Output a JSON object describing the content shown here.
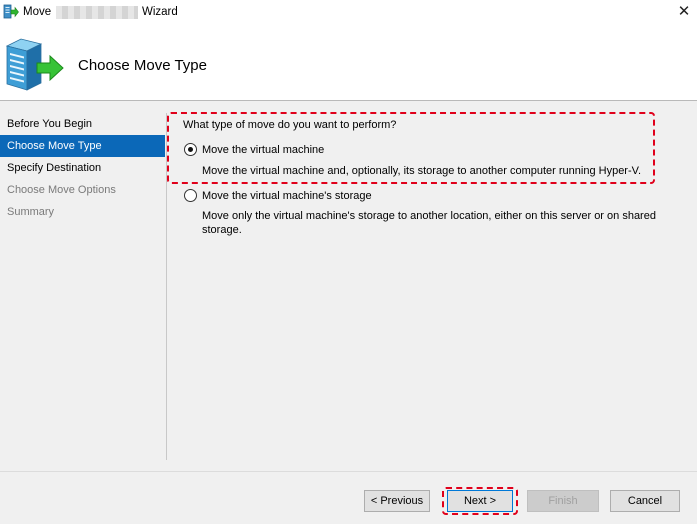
{
  "window": {
    "title_left": "Move",
    "title_right": "Wizard",
    "close_glyph": "✕"
  },
  "header": {
    "title": "Choose Move Type",
    "icon": "server-arrow-icon"
  },
  "sidebar": {
    "items": [
      {
        "label": "Before You Begin",
        "state": "done"
      },
      {
        "label": "Choose Move Type",
        "state": "active"
      },
      {
        "label": "Specify Destination",
        "state": "done"
      },
      {
        "label": "Choose Move Options",
        "state": "todo"
      },
      {
        "label": "Summary",
        "state": "todo"
      }
    ]
  },
  "main": {
    "question": "What type of move do you want to perform?",
    "options": [
      {
        "label": "Move the virtual machine",
        "description": "Move the virtual machine and, optionally, its storage to another computer running Hyper-V.",
        "checked": true
      },
      {
        "label": "Move the virtual machine's storage",
        "description": "Move only the virtual machine's storage to another location, either on this server or on shared storage.",
        "checked": false
      }
    ]
  },
  "buttons": {
    "previous": "< Previous",
    "next": "Next >",
    "finish": "Finish",
    "cancel": "Cancel"
  },
  "colors": {
    "active_item": "#0b68b8",
    "highlight": "#e0001b",
    "panel_bg": "#f0f0f0"
  }
}
